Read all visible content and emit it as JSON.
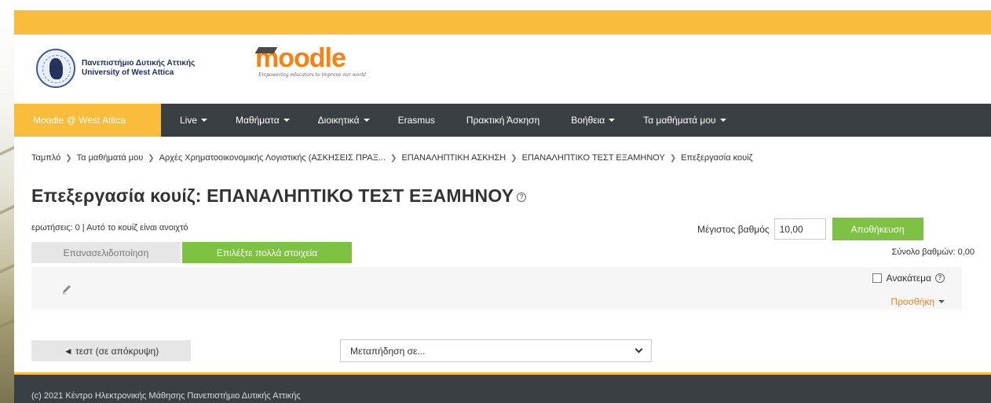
{
  "brand": {
    "university_name_el": "Πανεπιστήμιο Δυτικής Αττικής",
    "university_name_en": "University of West Attica",
    "moodle_wordmark": "moodle",
    "moodle_tagline": "Empowering educators to improve our world",
    "seal_icon": "university-seal-icon"
  },
  "nav": {
    "brand": "Moodle @ West Attica",
    "items": [
      {
        "label": "Live",
        "dropdown": true
      },
      {
        "label": "Μαθήματα",
        "dropdown": true
      },
      {
        "label": "Διοικητικά",
        "dropdown": true
      },
      {
        "label": "Erasmus",
        "dropdown": false
      },
      {
        "label": "Πρακτική Άσκηση",
        "dropdown": false
      },
      {
        "label": "Βοήθεια",
        "dropdown": true
      },
      {
        "label": "Τα μαθήματά μου",
        "dropdown": true
      }
    ]
  },
  "breadcrumb": [
    "Ταμπλό",
    "Τα μαθήματά μου",
    "Αρχές Χρηματοοικονομικής Λογιστικής (ΑΣΚΗΣΕΙΣ ΠΡΑΞ...",
    "ΕΠΑΝΑΛΗΠΤΙΚΗ ΑΣΚΗΣΗ",
    "ΕΠΑΝΑΛΗΠΤΙΚΟ ΤΕΣΤ ΕΞΑΜΗΝΟΥ",
    "Επεξεργασία κουίζ"
  ],
  "page": {
    "title": "Επεξεργασία κουίζ: ΕΠΑΝΑΛΗΠΤΙΚΟ ΤΕΣΤ ΕΞΑΜΗΝΟΥ",
    "help_icon_glyph": "?",
    "quiz_status": "ερωτήσεις: 0 | Αυτό το κουίζ είναι ανοιχτό",
    "max_grade_label": "Μέγιστος βαθμός",
    "max_grade_value": "10,00",
    "save_label": "Αποθήκευση",
    "repaginate_label": "Επανασελιδοποίηση",
    "select_multiple_label": "Επιλέξτε πολλά στοιχεία",
    "total_marks": "Σύνολο βαθμών: 0,00",
    "shuffle_label": "Ανακάτεμα",
    "shuffle_checked": false,
    "add_label": "Προσθήκη"
  },
  "navigation": {
    "prev_activity": "◄ τεστ (σε απόκρυψη)",
    "jump_placeholder": "Μεταπήδηση σε..."
  },
  "footer": {
    "text": "(c) 2021 Κέντρο Ηλεκτρονικής Μάθησης Πανεπιστήμιο Δυτικής Αττικής"
  },
  "colors": {
    "accent_yellow": "#f9bd3b",
    "nav_dark": "#3a3f44",
    "button_green": "#7dc242",
    "link_orange": "#f98012"
  }
}
